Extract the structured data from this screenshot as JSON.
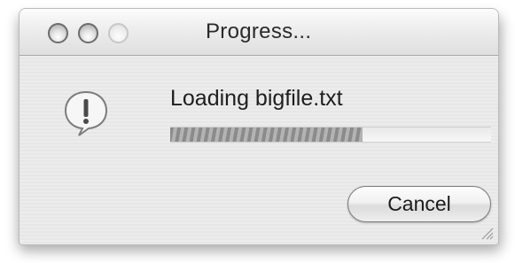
{
  "window": {
    "title": "Progress..."
  },
  "dialog": {
    "icon": "alert-icon",
    "message": "Loading bigfile.txt",
    "progress": 0.6
  },
  "buttons": {
    "cancel_label": "Cancel"
  }
}
